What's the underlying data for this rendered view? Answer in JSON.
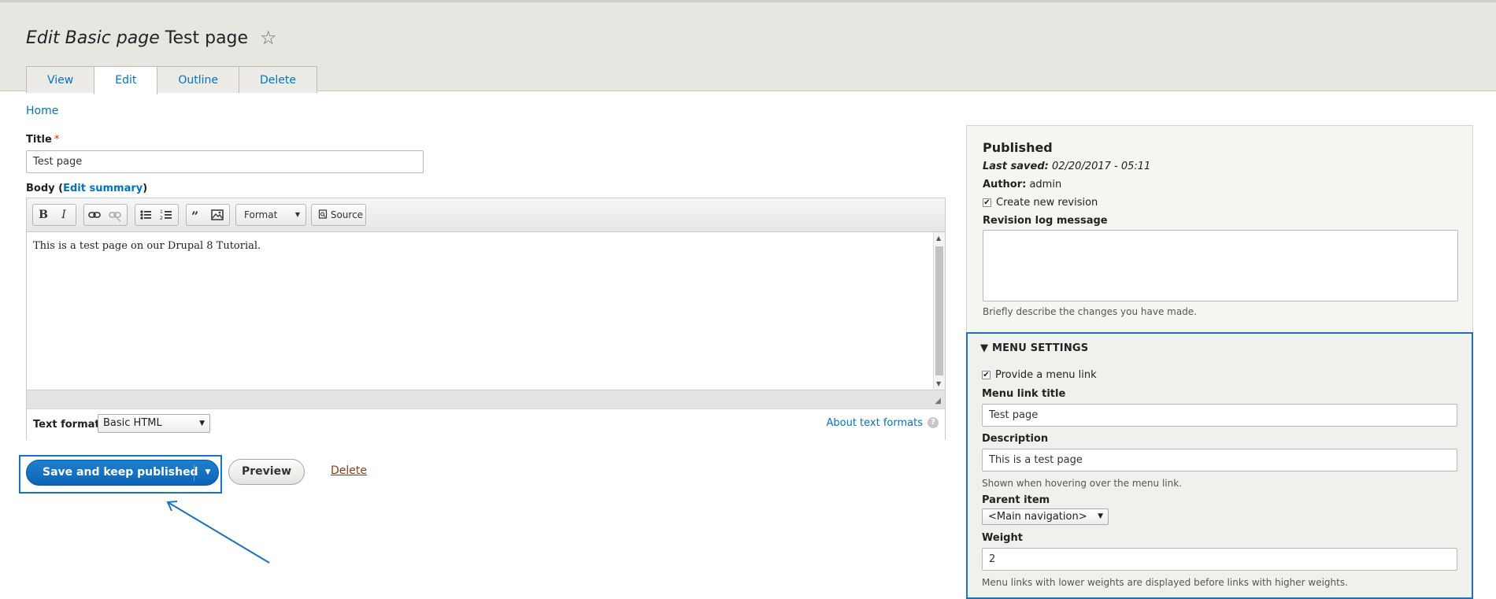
{
  "header": {
    "title_em": "Edit Basic page",
    "title_rest": "Test page",
    "star": "☆",
    "tabs": [
      "View",
      "Edit",
      "Outline",
      "Delete"
    ]
  },
  "breadcrumb": "Home",
  "form": {
    "title_label": "Title",
    "required_mark": "*",
    "title_value": "Test page",
    "body_label": "Body",
    "body_paren_open": "(",
    "edit_summary": "Edit summary",
    "body_paren_close": ")",
    "toolbar": {
      "bold": "B",
      "italic": "I",
      "format": "Format",
      "source": "Source"
    },
    "body_text": "This is a test page on our Drupal 8 Tutorial.",
    "text_format_label": "Text format",
    "text_format_value": "Basic HTML",
    "about_formats": "About text formats",
    "help": "?"
  },
  "actions": {
    "save": "Save and keep published",
    "preview": "Preview",
    "delete": "Delete"
  },
  "sidebar": {
    "status": "Published",
    "last_saved_label": "Last saved:",
    "last_saved_value": "02/20/2017 - 05:11",
    "author_label": "Author:",
    "author_value": "admin",
    "create_revision": "Create new revision",
    "revision_log_label": "Revision log message",
    "revision_log_value": "",
    "revision_log_desc": "Briefly describe the changes you have made.",
    "menu": {
      "heading": "MENU SETTINGS",
      "provide_link": "Provide a menu link",
      "link_title_label": "Menu link title",
      "link_title_value": "Test page",
      "description_label": "Description",
      "description_value": "This is a test page",
      "description_help": "Shown when hovering over the menu link.",
      "parent_label": "Parent item",
      "parent_value": "<Main navigation>",
      "weight_label": "Weight",
      "weight_value": "2",
      "weight_help": "Menu links with lower weights are displayed before links with higher weights."
    }
  },
  "colors": {
    "accent": "#1a72c2",
    "link": "#0074bd",
    "header_bg": "#e8e6e1"
  }
}
